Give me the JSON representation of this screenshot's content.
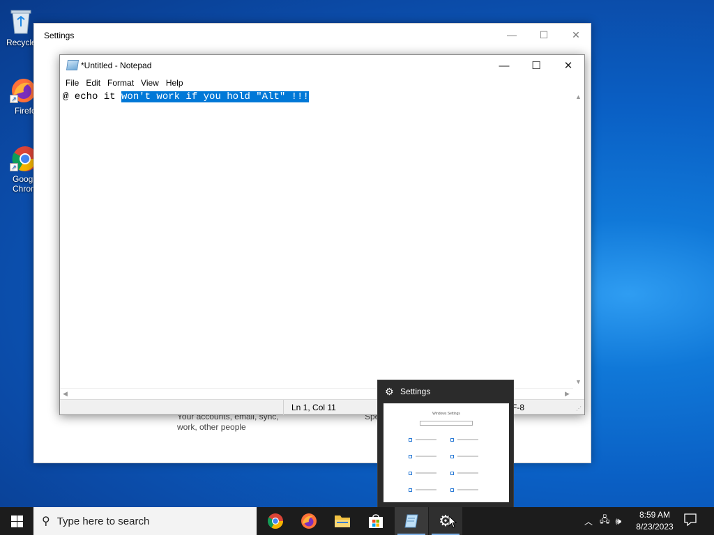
{
  "desktop": {
    "icons": [
      {
        "label": "Recycle",
        "name": "recycle-bin"
      },
      {
        "label": "Firefo",
        "name": "firefox-shortcut"
      },
      {
        "label": "Goog\nChron",
        "name": "chrome-shortcut"
      }
    ]
  },
  "settings_window": {
    "title": "Settings",
    "peek_text_line1": "Your accounts, email, sync,",
    "peek_text_line2": "work, other people",
    "peek_text_partial": "Spe"
  },
  "notepad": {
    "title": "*Untitled - Notepad",
    "menu": [
      "File",
      "Edit",
      "Format",
      "View",
      "Help"
    ],
    "text_before_selection": "@ echo it ",
    "text_selected": "won't work if you hold \"Alt\" !!!",
    "status": {
      "position": "Ln 1, Col 11",
      "encoding": "UTF-8"
    }
  },
  "thumbnail": {
    "title": "Settings",
    "preview_heading": "Windows Settings"
  },
  "taskbar": {
    "search_placeholder": "Type here to search",
    "apps": [
      "chrome",
      "firefox",
      "file-explorer",
      "microsoft-store",
      "notepad",
      "settings"
    ],
    "clock_time": "8:59 AM",
    "clock_date": "8/23/2023"
  },
  "colors": {
    "selection": "#0078d7",
    "taskbar": "#1c1c1c",
    "desktop_accent": "#1078d8"
  }
}
